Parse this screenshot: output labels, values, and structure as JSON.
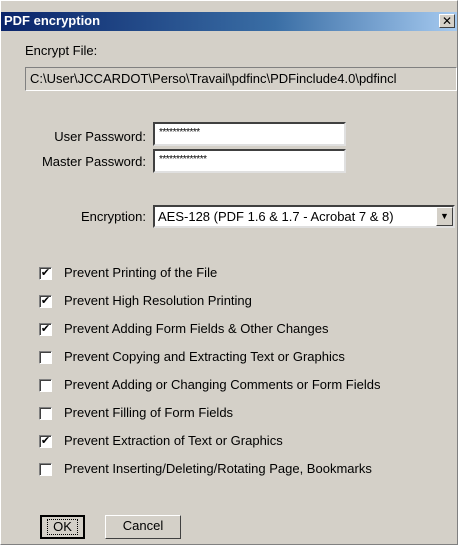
{
  "window": {
    "title": "PDF encryption",
    "close_label": "✕"
  },
  "encrypt_file": {
    "label": "Encrypt File:",
    "path": "C:\\User\\JCCARDOT\\Perso\\Travail\\pdfinc\\PDFinclude4.0\\pdfincl"
  },
  "user_password": {
    "label": "User Password:",
    "value": "************"
  },
  "master_password": {
    "label": "Master Password:",
    "value": "**************"
  },
  "encryption": {
    "label": "Encryption:",
    "selected": "AES-128 (PDF 1.6 & 1.7 - Acrobat 7 & 8)"
  },
  "options": [
    {
      "label": "Prevent Printing of the File",
      "checked": true
    },
    {
      "label": "Prevent High Resolution Printing",
      "checked": true
    },
    {
      "label": "Prevent Adding Form Fields & Other Changes",
      "checked": true
    },
    {
      "label": "Prevent Copying and Extracting Text or Graphics",
      "checked": false
    },
    {
      "label": "Prevent Adding or Changing Comments or Form Fields",
      "checked": false
    },
    {
      "label": "Prevent Filling of Form Fields",
      "checked": false
    },
    {
      "label": "Prevent Extraction of Text or Graphics",
      "checked": true
    },
    {
      "label": "Prevent Inserting/Deleting/Rotating Page, Bookmarks",
      "checked": false
    }
  ],
  "buttons": {
    "ok": "OK",
    "cancel": "Cancel"
  }
}
